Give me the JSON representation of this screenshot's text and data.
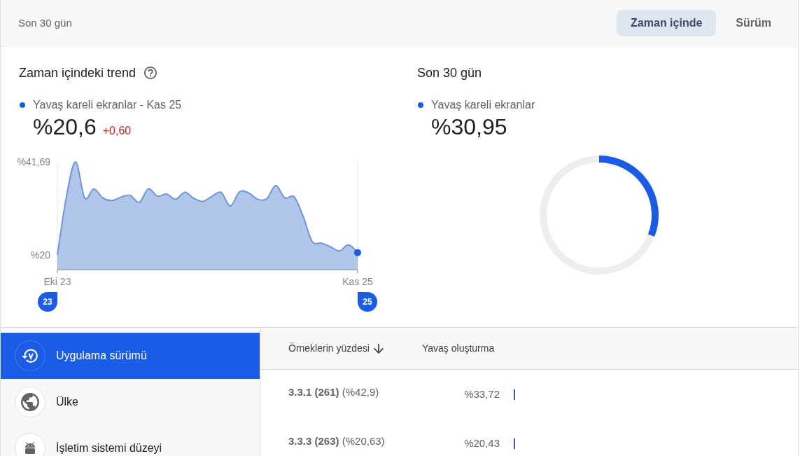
{
  "header": {
    "period": "Son 30 gün",
    "tabs": [
      {
        "label": "Zaman içinde",
        "selected": true
      },
      {
        "label": "Sürüm",
        "selected": false
      }
    ]
  },
  "trend_panel": {
    "title": "Zaman içindeki trend",
    "legend": "Yavaş kareli ekranlar - Kas 25",
    "value": "%20,6",
    "change": "+0,60",
    "chart_data": {
      "type": "area",
      "categories": [
        "Eki 23",
        null,
        null,
        null,
        null,
        null,
        null,
        null,
        null,
        null,
        null,
        null,
        null,
        null,
        null,
        null,
        null,
        null,
        null,
        null,
        null,
        null,
        null,
        null,
        null,
        null,
        null,
        null,
        null,
        null,
        null,
        null,
        null,
        "Kas 25"
      ],
      "series": [
        {
          "color": "#6f95d8",
          "values": [
            20.1,
            33.7,
            41.69,
            33.3,
            35.4,
            33.3,
            32.7,
            33.5,
            33.9,
            32.3,
            35.4,
            33.7,
            34.2,
            33.0,
            34.6,
            33.2,
            32.5,
            33.7,
            34.6,
            31.4,
            34.7,
            34.5,
            33.0,
            33.1,
            36.2,
            33.3,
            33.6,
            29.1,
            23.2,
            22.8,
            22.0,
            21.0,
            22.4,
            20.6
          ]
        }
      ],
      "ylim": [
        16.64,
        41.69
      ],
      "yticks": [
        {
          "value": 41.69,
          "label": "%41,69"
        },
        {
          "value": 20,
          "label": "%20"
        }
      ]
    },
    "range_handles": [
      {
        "label": "23"
      },
      {
        "label": "25"
      }
    ]
  },
  "summary_panel": {
    "title": "Son 30 gün",
    "legend": "Yavaş kareli ekranlar",
    "value": "%30,95",
    "chart_data": {
      "type": "donut",
      "values": [
        30.95,
        69.05
      ]
    }
  },
  "sidebar": {
    "items": [
      {
        "label": "Uygulama sürümü",
        "kind": "version",
        "selected": true
      },
      {
        "label": "Ülke",
        "kind": "country",
        "selected": false
      },
      {
        "label": "İşletim sistemi düzeyi",
        "kind": "os",
        "selected": false
      }
    ]
  },
  "table": {
    "columns": [
      {
        "label": "Örneklerin yüzdesi",
        "sorted": true
      },
      {
        "label": "Yavaş oluşturma",
        "sorted": false
      }
    ],
    "rows": [
      {
        "version": "**3.3.1 (261)** (%42,9)",
        "slow_rendering": "%33,72"
      },
      {
        "version": "**3.3.3 (263)** (%20,63)",
        "slow_rendering": "%20,43"
      }
    ]
  }
}
